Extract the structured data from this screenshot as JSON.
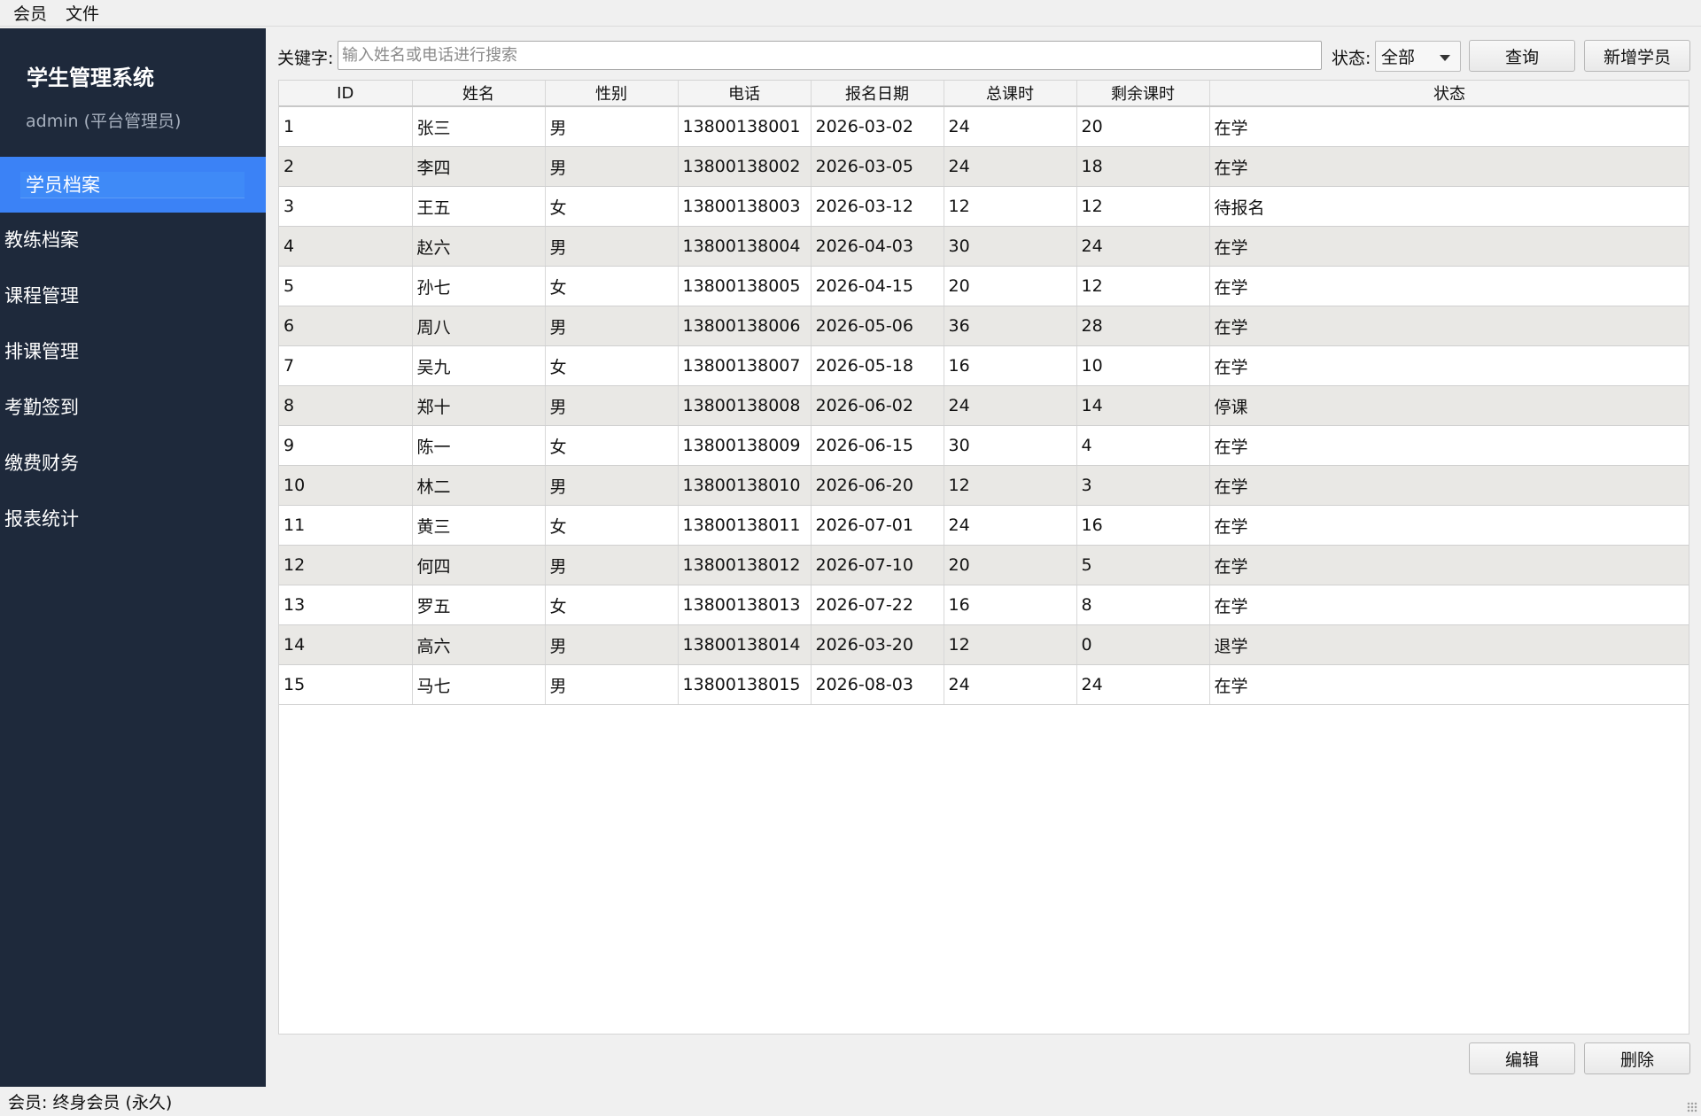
{
  "menubar": {
    "items": [
      {
        "label": "会员"
      },
      {
        "label": "文件"
      }
    ]
  },
  "sidebar": {
    "title": "学生管理系统",
    "user": "admin (平台管理员)",
    "items": [
      {
        "label": "学员档案",
        "active": true
      },
      {
        "label": "教练档案"
      },
      {
        "label": "课程管理"
      },
      {
        "label": "排课管理"
      },
      {
        "label": "考勤签到"
      },
      {
        "label": "缴费财务"
      },
      {
        "label": "报表统计"
      }
    ]
  },
  "filter": {
    "keyword_label": "关键字:",
    "search_placeholder": "输入姓名或电话进行搜索",
    "search_value": "",
    "status_label": "状态:",
    "status_value": "全部",
    "query_label": "查询",
    "add_label": "新增学员"
  },
  "table": {
    "columns": [
      "ID",
      "姓名",
      "性别",
      "电话",
      "报名日期",
      "总课时",
      "剩余课时",
      "状态"
    ],
    "rows": [
      [
        "1",
        "张三",
        "男",
        "13800138001",
        "2026-03-02",
        "24",
        "20",
        "在学"
      ],
      [
        "2",
        "李四",
        "男",
        "13800138002",
        "2026-03-05",
        "24",
        "18",
        "在学"
      ],
      [
        "3",
        "王五",
        "女",
        "13800138003",
        "2026-03-12",
        "12",
        "12",
        "待报名"
      ],
      [
        "4",
        "赵六",
        "男",
        "13800138004",
        "2026-04-03",
        "30",
        "24",
        "在学"
      ],
      [
        "5",
        "孙七",
        "女",
        "13800138005",
        "2026-04-15",
        "20",
        "12",
        "在学"
      ],
      [
        "6",
        "周八",
        "男",
        "13800138006",
        "2026-05-06",
        "36",
        "28",
        "在学"
      ],
      [
        "7",
        "吴九",
        "女",
        "13800138007",
        "2026-05-18",
        "16",
        "10",
        "在学"
      ],
      [
        "8",
        "郑十",
        "男",
        "13800138008",
        "2026-06-02",
        "24",
        "14",
        "停课"
      ],
      [
        "9",
        "陈一",
        "女",
        "13800138009",
        "2026-06-15",
        "30",
        "4",
        "在学"
      ],
      [
        "10",
        "林二",
        "男",
        "13800138010",
        "2026-06-20",
        "12",
        "3",
        "在学"
      ],
      [
        "11",
        "黄三",
        "女",
        "13800138011",
        "2026-07-01",
        "24",
        "16",
        "在学"
      ],
      [
        "12",
        "何四",
        "男",
        "13800138012",
        "2026-07-10",
        "20",
        "5",
        "在学"
      ],
      [
        "13",
        "罗五",
        "女",
        "13800138013",
        "2026-07-22",
        "16",
        "8",
        "在学"
      ],
      [
        "14",
        "高六",
        "男",
        "13800138014",
        "2026-03-20",
        "12",
        "0",
        "退学"
      ],
      [
        "15",
        "马七",
        "男",
        "13800138015",
        "2026-08-03",
        "24",
        "24",
        "在学"
      ]
    ]
  },
  "actions": {
    "edit_label": "编辑",
    "delete_label": "删除"
  },
  "statusbar": {
    "text": "会员: 终身会员 (永久)"
  },
  "colors": {
    "sidebar_bg": "#1e293b",
    "active_nav": "#3b82f6",
    "alt_row": "#e9e8e5"
  }
}
